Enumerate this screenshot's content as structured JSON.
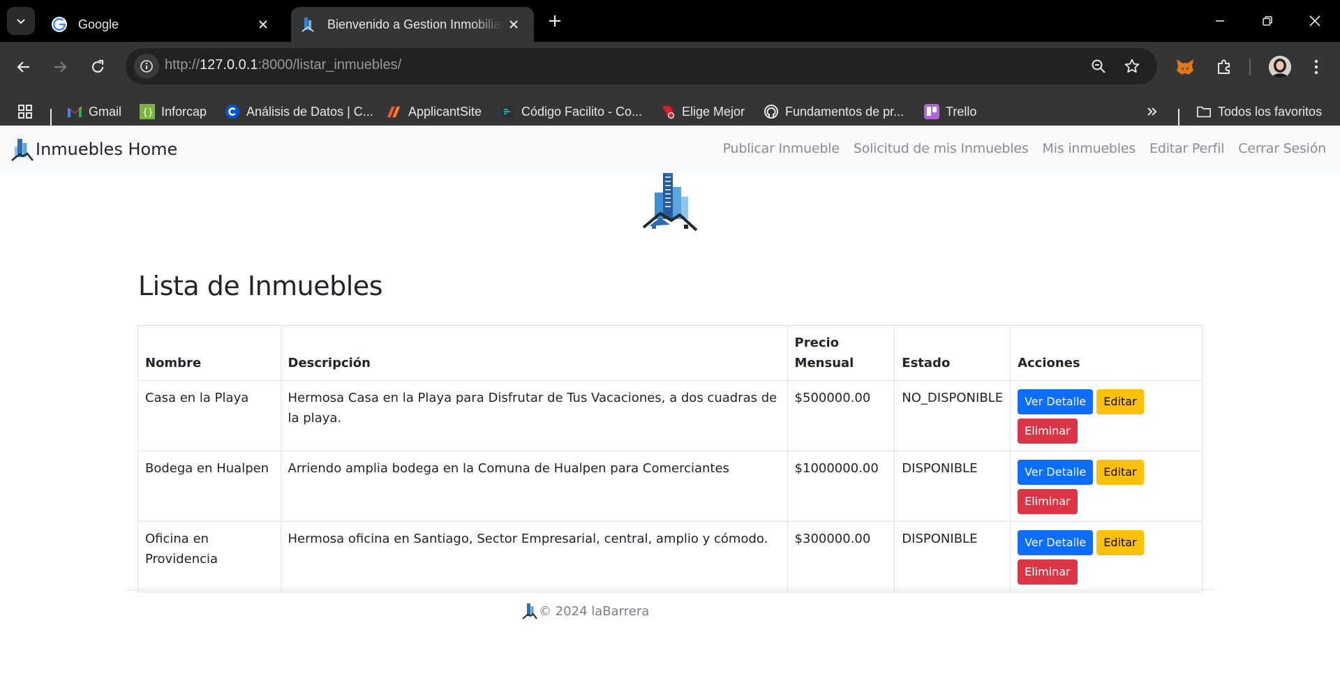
{
  "browser": {
    "tabs": [
      {
        "title": "Google",
        "active": false
      },
      {
        "title": "Bienvenido a Gestion Inmobiliaria",
        "active": true
      }
    ],
    "url_scheme": "http://",
    "url_host": "127.0.0.1",
    "url_rest": ":8000/listar_inmuebles/",
    "bookmarks": [
      {
        "label": "Gmail",
        "icon": "gmail-icon"
      },
      {
        "label": "Inforcap",
        "icon": "inforcap-icon"
      },
      {
        "label": "Análisis de Datos | C...",
        "icon": "coursera-icon"
      },
      {
        "label": "ApplicantSite",
        "icon": "applicantsite-icon"
      },
      {
        "label": "Código Facilito - Co...",
        "icon": "codigofacilito-icon"
      },
      {
        "label": "Elige Mejor",
        "icon": "eligemejor-icon"
      },
      {
        "label": "Fundamentos de pr...",
        "icon": "github-icon"
      },
      {
        "label": "Trello",
        "icon": "trello-icon"
      }
    ],
    "all_bookmarks": "Todos los favoritos"
  },
  "site": {
    "brand": "Inmuebles Home",
    "nav": [
      "Publicar Inmueble",
      "Solicitud de mis Inmuebles",
      "Mis inmuebles",
      "Editar Perfil",
      "Cerrar Sesión"
    ]
  },
  "main": {
    "title": "Lista de Inmuebles",
    "headers": {
      "nombre": "Nombre",
      "descripcion": "Descripción",
      "precio": "Precio Mensual",
      "estado": "Estado",
      "acciones": "Acciones"
    },
    "rows": [
      {
        "nombre": "Casa en la Playa",
        "descripcion": "Hermosa Casa en la Playa para Disfrutar de Tus Vacaciones, a dos cuadras de la playa.",
        "precio": "$500000.00",
        "estado": "NO_DISPONIBLE"
      },
      {
        "nombre": "Bodega en Hualpen",
        "descripcion": "Arriendo amplia bodega en la Comuna de Hualpen para Comerciantes",
        "precio": "$1000000.00",
        "estado": "DISPONIBLE"
      },
      {
        "nombre": "Oficina en Providencia",
        "descripcion": "Hermosa oficina en Santiago, Sector Empresarial, central, amplio y cómodo.",
        "precio": "$300000.00",
        "estado": "DISPONIBLE"
      }
    ],
    "actions": {
      "ver": "Ver Detalle",
      "editar": "Editar",
      "eliminar": "Eliminar"
    }
  },
  "footer": {
    "text": "© 2024 laBarrera"
  },
  "colors": {
    "primary": "#0d6efd",
    "warning": "#ffc107",
    "danger": "#dc3545",
    "navbar": "#f8f9fa"
  }
}
